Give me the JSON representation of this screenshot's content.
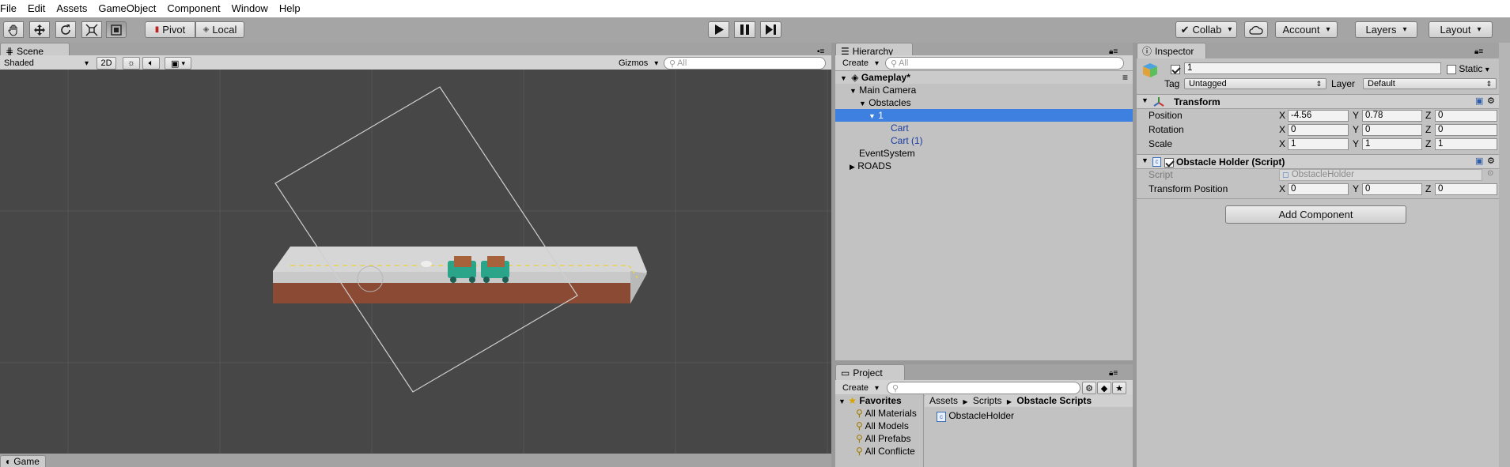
{
  "menu": [
    "File",
    "Edit",
    "Assets",
    "GameObject",
    "Component",
    "Window",
    "Help"
  ],
  "toolbar": {
    "pivot_label": "Pivot",
    "local_label": "Local",
    "collab_label": "Collab",
    "account_label": "Account",
    "layers_label": "Layers",
    "layout_label": "Layout"
  },
  "scene": {
    "tab_label": "Scene",
    "shading_mode": "Shaded",
    "mode_2d": "2D",
    "gizmos_label": "Gizmos",
    "search_placeholder": "All"
  },
  "game": {
    "tab_label": "Game"
  },
  "hierarchy": {
    "tab_label": "Hierarchy",
    "create_label": "Create",
    "search_placeholder": "All",
    "scene_name": "Gameplay*",
    "items": [
      {
        "label": "Main Camera",
        "depth": 1,
        "expanded": true
      },
      {
        "label": "Obstacles",
        "depth": 2,
        "expanded": true
      },
      {
        "label": "1",
        "depth": 3,
        "expanded": true,
        "selected": true
      },
      {
        "label": "Cart",
        "depth": 4,
        "prefab": true
      },
      {
        "label": "Cart (1)",
        "depth": 4,
        "prefab": true
      },
      {
        "label": "EventSystem",
        "depth": 1
      },
      {
        "label": "ROADS",
        "depth": 1,
        "collapsed": true
      }
    ]
  },
  "project": {
    "tab_label": "Project",
    "create_label": "Create",
    "favorites_label": "Favorites",
    "favorites": [
      "All Materials",
      "All Models",
      "All Prefabs",
      "All Conflicte"
    ],
    "breadcrumb": [
      "Assets",
      "Scripts",
      "Obstacle Scripts"
    ],
    "files": [
      "ObstacleHolder"
    ]
  },
  "inspector": {
    "tab_label": "Inspector",
    "object_name": "1",
    "static_label": "Static",
    "tag_label": "Tag",
    "tag_value": "Untagged",
    "layer_label": "Layer",
    "layer_value": "Default",
    "transform": {
      "title": "Transform",
      "position_label": "Position",
      "rotation_label": "Rotation",
      "scale_label": "Scale",
      "position": {
        "x": "-4.56",
        "y": "0.78",
        "z": "0"
      },
      "rotation": {
        "x": "0",
        "y": "0",
        "z": "0"
      },
      "scale": {
        "x": "1",
        "y": "1",
        "z": "1"
      }
    },
    "script_component": {
      "title": "Obstacle Holder (Script)",
      "script_label": "Script",
      "script_value": "ObstacleHolder",
      "transform_position_label": "Transform Position",
      "transform_position": {
        "x": "0",
        "y": "0",
        "z": "0"
      }
    },
    "add_component_label": "Add Component",
    "axis": {
      "x": "X",
      "y": "Y",
      "z": "Z"
    }
  }
}
